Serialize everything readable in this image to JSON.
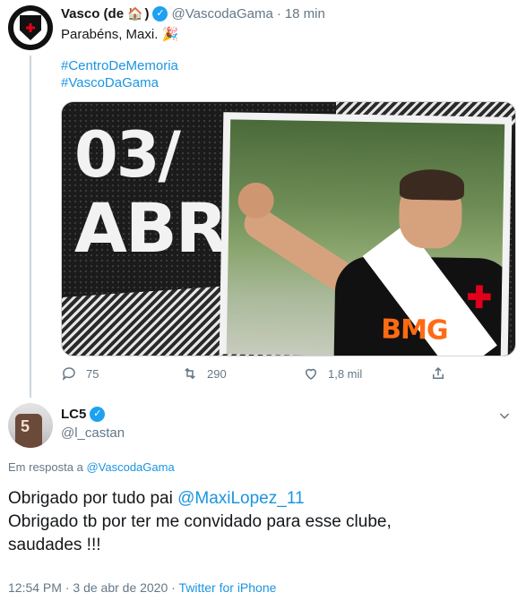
{
  "tweet": {
    "name": "Vasco (de",
    "name_emoji": "🏠",
    "name_suffix": ")",
    "handle": "@VascodaGama",
    "time": "18 min",
    "text": "Parabéns, Maxi. 🎉",
    "hashtags": [
      "#CentroDeMemoria",
      "#VascoDaGama"
    ],
    "media": {
      "day": "03/",
      "month": "ABR",
      "sponsor": "BMG"
    },
    "actions": {
      "replies": "75",
      "retweets": "290",
      "likes": "1,8 mil"
    }
  },
  "reply": {
    "name": "LC5",
    "handle": "@l_castan",
    "avatar_number": "5",
    "reply_prefix": "Em resposta a",
    "reply_to": "@VascodaGama",
    "line1_text": "Obrigado por tudo pai",
    "line1_mention": "@MaxiLopez_11",
    "line2": "Obrigado tb por ter me convidado para esse clube,",
    "line3": "saudades !!!",
    "time": "12:54 PM",
    "date": "3 de abr de 2020",
    "source": "Twitter for iPhone"
  },
  "colors": {
    "link": "#1b95e0",
    "verified": "#1da1f2",
    "muted": "#657786",
    "text": "#14171a"
  },
  "icons": [
    "reply-icon",
    "retweet-icon",
    "like-icon",
    "share-icon",
    "verified-icon",
    "chevron-down-icon"
  ]
}
